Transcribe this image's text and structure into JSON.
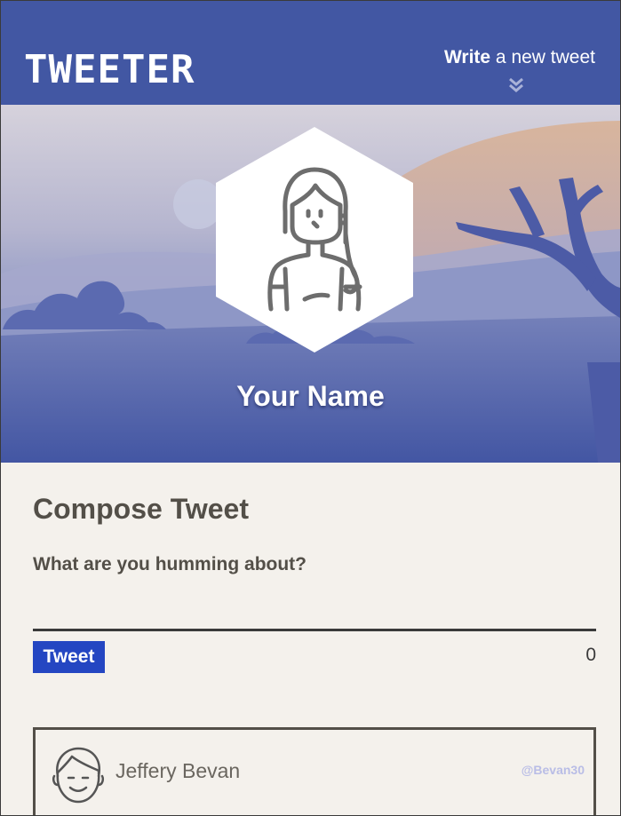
{
  "nav": {
    "logo": "TWEETER",
    "write_bold": "Write",
    "write_rest": " a new tweet",
    "icon": "double-chevron-down-icon"
  },
  "profile": {
    "name": "Your Name",
    "avatar_icon": "user-avatar-icon"
  },
  "compose": {
    "title": "Compose Tweet",
    "prompt": "What are you humming about?",
    "input_value": "",
    "tweet_button": "Tweet",
    "char_count": "0"
  },
  "tweets": [
    {
      "author": "Jeffery Bevan",
      "handle": "@Bevan30",
      "avatar_icon": "user-avatar-icon"
    }
  ],
  "colors": {
    "nav_bg": "#4257a3",
    "page_bg": "#f4f1ec",
    "button_bg": "#2446c2",
    "handle": "#b9bde6"
  }
}
